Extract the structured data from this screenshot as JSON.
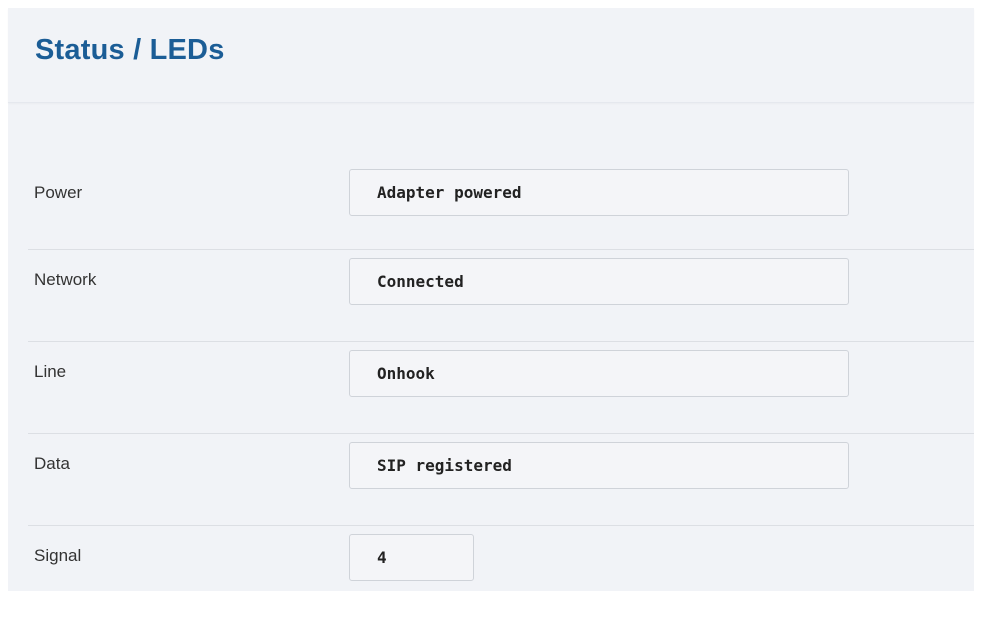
{
  "page": {
    "title": "Status / LEDs"
  },
  "status_rows": [
    {
      "label": "Power",
      "value": "Adapter powered"
    },
    {
      "label": "Network",
      "value": "Connected"
    },
    {
      "label": "Line",
      "value": "Onhook"
    },
    {
      "label": "Data",
      "value": "SIP registered"
    },
    {
      "label": "Signal",
      "value": "4"
    }
  ],
  "colors": {
    "title": "#1b5d96",
    "panel_background": "#f1f3f7",
    "value_border": "#cfd3d9",
    "divider": "#dcdfe4"
  }
}
